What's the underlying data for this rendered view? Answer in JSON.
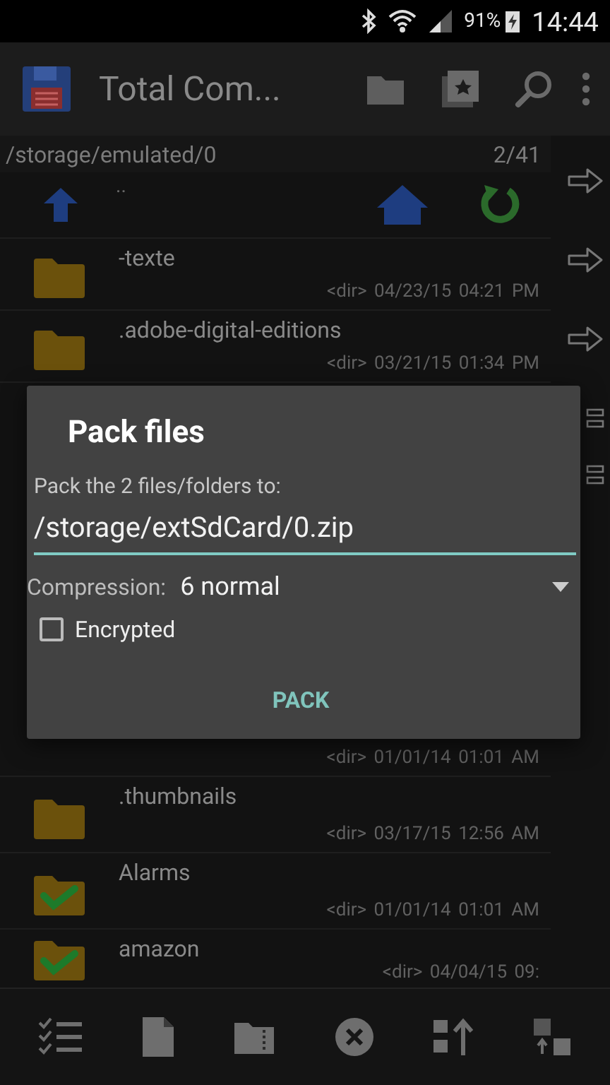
{
  "status_bar": {
    "battery": "91%",
    "time": "14:44"
  },
  "app_bar": {
    "title": "Total Com..."
  },
  "panel": {
    "path": "/storage/emulated/0",
    "count": "2/41",
    "parent_entry": ".."
  },
  "files_top": [
    {
      "name": "-texte",
      "info": "<dir> 04/23/15 04:21 PM",
      "selected": false
    },
    {
      "name": ".adobe-digital-editions",
      "info": "<dir> 03/21/15 01:34 PM",
      "selected": false
    }
  ],
  "files_bottom": [
    {
      "info": "<dir> 01/01/14 01:01 AM"
    },
    {
      "name": ".thumbnails",
      "info": "<dir> 03/17/15 12:56 AM",
      "selected": false
    },
    {
      "name": "Alarms",
      "info": "<dir> 01/01/14 01:01 AM",
      "selected": true
    },
    {
      "name": "amazon",
      "info": "<dir> 04/04/15 09:",
      "selected": true
    }
  ],
  "side_buttons": [
    {
      "kind": "arrow"
    },
    {
      "kind": "arrow"
    },
    {
      "kind": "arrow"
    },
    {
      "kind": "lines"
    },
    {
      "kind": "lines"
    }
  ],
  "dialog": {
    "title": "Pack files",
    "prompt": "Pack the 2 files/folders to:",
    "target": "/storage/extSdCard/0.zip",
    "compression_label": "Compression:",
    "compression": "6 normal",
    "options": [
      {
        "label": "Encrypted",
        "checked": false
      }
    ],
    "buttons": [
      "PACK"
    ]
  }
}
